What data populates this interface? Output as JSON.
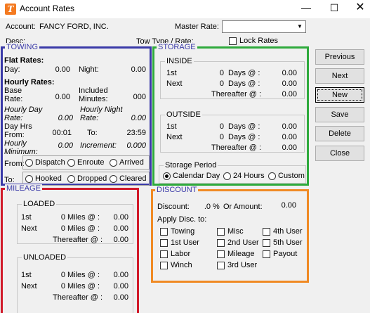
{
  "window": {
    "title": "Account Rates",
    "icon_letter": "T",
    "minimize": "—",
    "maximize": "☐",
    "close": "✕"
  },
  "header": {
    "account_label": "Account:",
    "account_value": "FANCY FORD, INC.",
    "master_rate_label": "Master Rate:",
    "master_rate_value": "",
    "desc_label": "Desc:",
    "tow_type_label": "Tow Type / Rate:",
    "lock_rates_label": "Lock Rates"
  },
  "towing": {
    "title": "TOWING",
    "flat_rates": "Flat Rates:",
    "day_label": "Day:",
    "day_value": "0.00",
    "night_label": "Night:",
    "night_value": "0.00",
    "hourly_rates": "Hourly Rates:",
    "base_rate_1": "Base",
    "base_rate_2": "Rate:",
    "base_rate_value": "0.00",
    "included_1": "Included",
    "included_2": "Minutes:",
    "included_value": "000",
    "hourly_day_1": "Hourly Day",
    "hourly_day_2": "Rate:",
    "hourly_day_value": "0.00",
    "hourly_night_1": "Hourly Night",
    "hourly_night_2": "Rate:",
    "hourly_night_value": "0.00",
    "day_hrs_1": "Day Hrs",
    "day_hrs_2": "From:",
    "day_hrs_from": "00:01",
    "to_label": "To:",
    "day_hrs_to": "23:59",
    "hourly_min_1": "Hourly",
    "hourly_min_2": "Minimum:",
    "hourly_min_value": "0.00",
    "increment_label": "Increment:",
    "increment_value": "0.000",
    "from_label": "From:",
    "to2_label": "To:",
    "from_options": [
      "Dispatch",
      "Enroute",
      "Arrived"
    ],
    "to_options": [
      "Hooked",
      "Dropped",
      "Cleared"
    ]
  },
  "storage": {
    "title": "STORAGE",
    "inside": {
      "title": "INSIDE",
      "rows": [
        {
          "label": "1st",
          "days": "0",
          "days_label": "Days @ :",
          "value": "0.00"
        },
        {
          "label": "Next",
          "days": "0",
          "days_label": "Days @ :",
          "value": "0.00"
        }
      ],
      "thereafter_label": "Thereafter  @ :",
      "thereafter_value": "0.00"
    },
    "outside": {
      "title": "OUTSIDE",
      "rows": [
        {
          "label": "1st",
          "days": "0",
          "days_label": "Days @ :",
          "value": "0.00"
        },
        {
          "label": "Next",
          "days": "0",
          "days_label": "Days @ :",
          "value": "0.00"
        }
      ],
      "thereafter_label": "Thereafter  @ :",
      "thereafter_value": "0.00"
    },
    "period": {
      "title": "Storage Period",
      "options": [
        "Calendar Day",
        "24 Hours",
        "Custom"
      ],
      "selected": "Calendar Day"
    }
  },
  "mileage": {
    "title": "MILEAGE",
    "loaded": {
      "title": "LOADED",
      "rows": [
        {
          "label": "1st",
          "miles": "0",
          "miles_label": "Miles @ :",
          "value": "0.00"
        },
        {
          "label": "Next",
          "miles": "0",
          "miles_label": "Miles @ :",
          "value": "0.00"
        }
      ],
      "thereafter_label": "Thereafter  @ :",
      "thereafter_value": "0.00"
    },
    "unloaded": {
      "title": "UNLOADED",
      "rows": [
        {
          "label": "1st",
          "miles": "0",
          "miles_label": "Miles @ :",
          "value": "0.00"
        },
        {
          "label": "Next",
          "miles": "0",
          "miles_label": "Miles @ :",
          "value": "0.00"
        }
      ],
      "thereafter_label": "Thereafter  @ :",
      "thereafter_value": "0.00"
    }
  },
  "discount": {
    "title": "DISCOUNT",
    "discount_label": "Discount:",
    "discount_value": ".0",
    "percent": "%",
    "or_amount_label": "Or Amount:",
    "or_amount_value": "0.00",
    "apply_label": "Apply Disc. to:",
    "items": [
      "Towing",
      "Misc",
      "4th User",
      "1st User",
      "2nd User",
      "5th User",
      "Labor",
      "Mileage",
      "Payout",
      "Winch",
      "3rd User"
    ]
  },
  "buttons": {
    "previous": "Previous",
    "next": "Next",
    "new": "New",
    "save": "Save",
    "delete": "Delete",
    "close": "Close"
  },
  "colors": {
    "towing": "#3a3aa8",
    "storage": "#2eaa3c",
    "mileage": "#d11a2a",
    "discount": "#f08a24",
    "icon": "#f47a20"
  }
}
